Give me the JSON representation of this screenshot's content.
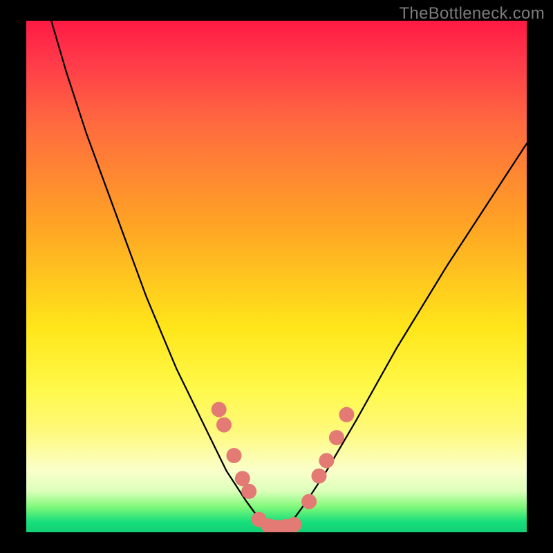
{
  "watermark": "TheBottleneck.com",
  "chart_data": {
    "type": "line",
    "title": "",
    "xlabel": "",
    "ylabel": "",
    "xlim": [
      0,
      100
    ],
    "ylim": [
      0,
      100
    ],
    "grid": false,
    "legend": false,
    "gradient_bands": [
      {
        "color": "#ff1a44",
        "stop": 0
      },
      {
        "color": "#ff6a3f",
        "stop": 20
      },
      {
        "color": "#ffa424",
        "stop": 40
      },
      {
        "color": "#ffe61a",
        "stop": 60
      },
      {
        "color": "#faffca",
        "stop": 88
      },
      {
        "color": "#16de7a",
        "stop": 98
      }
    ],
    "series": [
      {
        "name": "bottleneck-curve",
        "color": "#000000",
        "x": [
          5,
          8,
          12,
          18,
          24,
          30,
          36,
          40,
          44,
          47,
          50,
          53,
          56,
          60,
          66,
          74,
          84,
          96,
          100
        ],
        "y": [
          100,
          90,
          78,
          62,
          46,
          32,
          20,
          12,
          6,
          2,
          0.5,
          2,
          6,
          12,
          22,
          36,
          52,
          70,
          76
        ]
      }
    ],
    "markers": {
      "name": "highlight-dots",
      "color": "#e47a74",
      "radius": 11,
      "points": [
        {
          "x": 38.5,
          "y": 24
        },
        {
          "x": 39.5,
          "y": 21
        },
        {
          "x": 41.5,
          "y": 15
        },
        {
          "x": 43.2,
          "y": 10.5
        },
        {
          "x": 44.5,
          "y": 8
        },
        {
          "x": 46.5,
          "y": 2.5
        },
        {
          "x": 48.5,
          "y": 1.2
        },
        {
          "x": 50.0,
          "y": 1.0
        },
        {
          "x": 51.8,
          "y": 1.1
        },
        {
          "x": 53.5,
          "y": 1.5
        },
        {
          "x": 56.5,
          "y": 6
        },
        {
          "x": 58.5,
          "y": 11
        },
        {
          "x": 60,
          "y": 14
        },
        {
          "x": 62,
          "y": 18.5
        },
        {
          "x": 64,
          "y": 23
        }
      ]
    }
  }
}
